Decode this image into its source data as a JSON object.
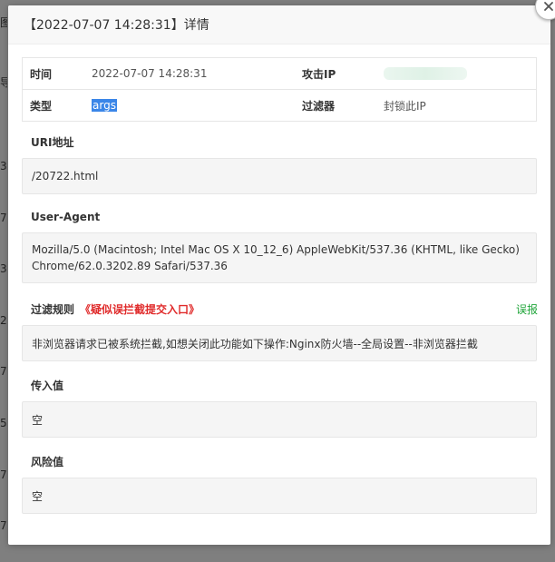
{
  "dialog": {
    "title": "【2022-07-07 14:28:31】详情"
  },
  "info": {
    "time_label": "时间",
    "time_value": "2022-07-07 14:28:31",
    "attack_ip_label": "攻击IP",
    "type_label": "类型",
    "type_value": "args",
    "filter_label": "过滤器",
    "filter_value": "封锁此IP"
  },
  "uri": {
    "label": "URI地址",
    "value": "/20722.html"
  },
  "user_agent": {
    "label": "User-Agent",
    "value": "Mozilla/5.0 (Macintosh; Intel Mac OS X 10_12_6) AppleWebKit/537.36 (KHTML, like Gecko) Chrome/62.0.3202.89 Safari/537.36"
  },
  "filter_rule": {
    "label": "过滤规则",
    "warn_link": "《疑似误拦截提交入口》",
    "report_link": "误报",
    "value": "非浏览器请求已被系统拦截,如想关闭此功能如下操作:Nginx防火墙--全局设置--非浏览器拦截"
  },
  "input_value": {
    "label": "传入值",
    "value": "空"
  },
  "risk_value": {
    "label": "风险值",
    "value": "空"
  },
  "background": {
    "fragments": [
      "图",
      "导",
      "3:",
      "7:",
      "3:",
      "2:",
      "7:",
      "5:",
      "7:",
      "7:",
      "7:"
    ]
  },
  "colors": {
    "accent_green": "#20a53a",
    "warning_red": "#e02b2b",
    "selection_blue": "#3a86e8"
  }
}
